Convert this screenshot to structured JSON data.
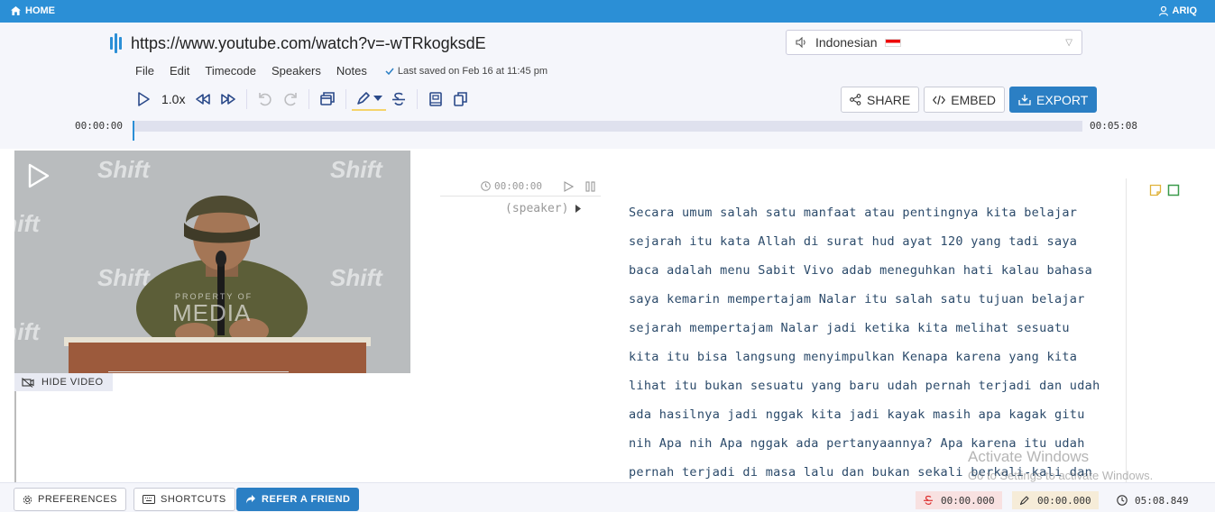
{
  "topbar": {
    "home_label": "HOME",
    "user_label": "ARIQ"
  },
  "header": {
    "url": "https://www.youtube.com/watch?v=-wTRkogksdE",
    "language": "Indonesian",
    "menu": [
      "File",
      "Edit",
      "Timecode",
      "Speakers",
      "Notes"
    ],
    "saved_status": "Last saved on Feb 16 at 11:45 pm",
    "speed": "1.0x"
  },
  "actions": {
    "share": "SHARE",
    "embed": "EMBED",
    "export": "EXPORT"
  },
  "timeline": {
    "start": "00:00:00",
    "end": "00:05:08",
    "progress": 0
  },
  "video": {
    "watermark": "Shift",
    "media_watermark": "MEDIA",
    "media_small": "PROPERTY OF",
    "hide_label": "HIDE VIDEO"
  },
  "segment": {
    "time": "00:00:00",
    "speaker": "(speaker)"
  },
  "transcript": [
    "Secara umum salah satu manfaat atau pentingnya kita belajar",
    "sejarah itu kata Allah di surat hud ayat 120 yang tadi saya",
    "baca adalah menu Sabit Vivo adab meneguhkan hati kalau bahasa",
    "saya kemarin mempertajam Nalar itu salah satu tujuan belajar",
    "sejarah mempertajam Nalar jadi ketika kita melihat sesuatu",
    "kita itu bisa langsung menyimpulkan Kenapa karena yang kita",
    "lihat itu bukan sesuatu yang baru udah pernah terjadi dan udah",
    "ada hasilnya jadi nggak kita jadi kayak masih apa kagak gitu",
    "nih Apa nih Apa nggak ada pertanyaannya? Apa karena itu udah",
    "pernah terjadi di masa lalu dan bukan sekali berkali-kali dan"
  ],
  "activate_windows": {
    "title": "Activate Windows",
    "subtitle": "Go to Settings to activate Windows."
  },
  "footer": {
    "preferences": "PREFERENCES",
    "shortcuts": "SHORTCUTS",
    "refer": "REFER A FRIEND",
    "strike_time": "00:00.000",
    "highlight_time": "00:00.000",
    "duration": "05:08.849"
  },
  "colors": {
    "accent": "#2b8fd6",
    "primary_button": "#2b7fc4",
    "transcript_text": "#2b4a6a"
  }
}
